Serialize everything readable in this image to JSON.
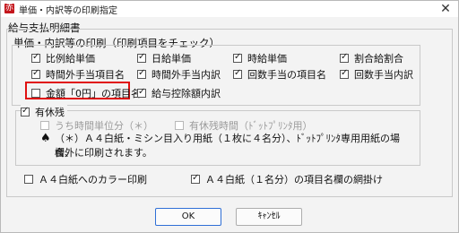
{
  "window": {
    "title": "単価・内訳等の印刷指定",
    "app_icon": "赤",
    "close_glyph": "✕"
  },
  "groups": {
    "outer_title": "給与支払明細書",
    "print_title": "単価・内訳等の印刷（印刷項目をチェック）",
    "leave_title": "有休残"
  },
  "print_items": [
    {
      "label": "比例給単価",
      "checked": true
    },
    {
      "label": "日給単価",
      "checked": true
    },
    {
      "label": "時給単価",
      "checked": true
    },
    {
      "label": "割合給割合",
      "checked": true
    },
    {
      "label": "時間外手当項目名",
      "checked": true
    },
    {
      "label": "時間外手当内訳",
      "checked": true
    },
    {
      "label": "回数手当の項目名",
      "checked": true
    },
    {
      "label": "回数手当内訳",
      "checked": true
    },
    {
      "label": "金額「0円」の項目名",
      "checked": false
    },
    {
      "label": "給与控除額内訳",
      "checked": true
    }
  ],
  "leave": {
    "main_checked": true,
    "sub1": {
      "label": "うち時間単位分（＊）",
      "checked": false
    },
    "sub2": {
      "label": "有休残時間（ﾄﾞｯﾄﾌﾟﾘﾝﾀ用）",
      "checked": false
    },
    "note_symbol": "♠",
    "note_line1": "（＊）Ａ４白紙・ミシン目入り用紙（１枚に４名分）、ﾄﾞｯﾄﾌﾟﾘﾝﾀ専用用紙の場合、",
    "note_line2": "欄外に印刷されます。"
  },
  "bottom": {
    "color_print": {
      "label": "Ａ４白紙へのカラー印刷",
      "checked": false
    },
    "mesh": {
      "label": "Ａ４白紙（１名分）の項目名欄の網掛け",
      "checked": true
    }
  },
  "buttons": {
    "ok": "OK",
    "cancel": "ｷｬﾝｾﾙ"
  }
}
